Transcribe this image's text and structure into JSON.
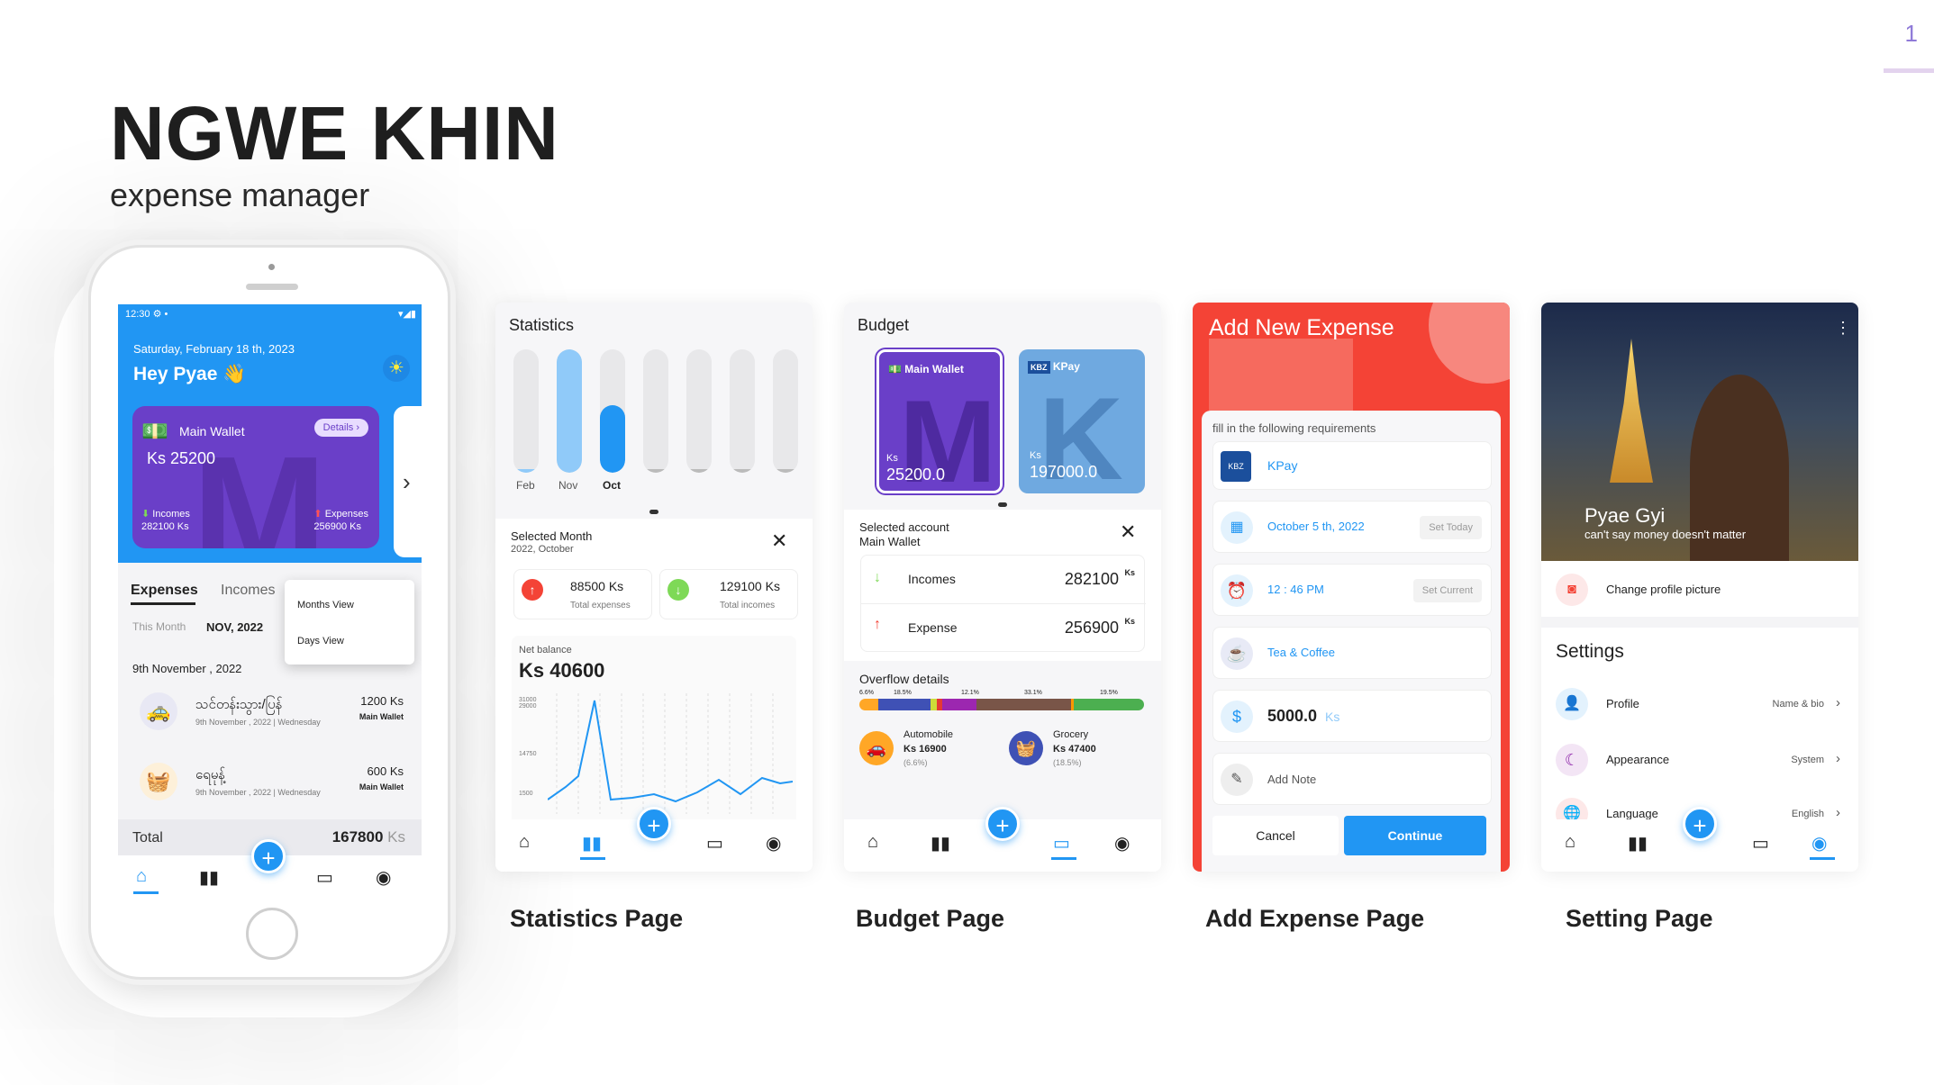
{
  "header": {
    "title": "NGWE KHIN",
    "subtitle": "expense manager",
    "page_number": "1"
  },
  "phone": {
    "status_time": "12:30",
    "date": "Saturday, February 18 th, 2023",
    "greeting": "Hey Pyae",
    "wave_emoji": "👋",
    "wallet": {
      "name": "Main Wallet",
      "details": "Details ›",
      "balance": "Ks 25200",
      "incomes_label": "Incomes",
      "incomes_value": "282100 Ks",
      "expenses_label": "Expenses",
      "expenses_value": "256900 Ks"
    },
    "tabs": {
      "expenses": "Expenses",
      "incomes": "Incomes"
    },
    "this_month": "This Month",
    "month": "NOV, 2022",
    "menu": {
      "months": "Months View",
      "days": "Days View"
    },
    "day_header": "9th November , 2022",
    "transactions": [
      {
        "name": "သင်တန်းသွား/ပြန်",
        "date": "9th November , 2022 | Wednesday",
        "amount": "1200 Ks",
        "wallet": "Main Wallet",
        "icon": "🚕",
        "bg": "#e8e8f4"
      },
      {
        "name": "ရေမုန့်",
        "date": "9th November , 2022 | Wednesday",
        "amount": "600 Ks",
        "wallet": "Main Wallet",
        "icon": "🧺",
        "bg": "#fdf0d9"
      }
    ],
    "total_label": "Total",
    "total_value": "167800",
    "total_unit": "Ks"
  },
  "statistics": {
    "title": "Statistics",
    "months": [
      "Feb",
      "Nov",
      "Oct"
    ],
    "bar_levels": [
      0.03,
      1.0,
      0.55,
      0.03,
      0.03,
      0.03,
      0.03
    ],
    "selected_label": "Selected Month",
    "selected_value": "2022, October",
    "total_expenses": "88500 Ks",
    "total_expenses_label": "Total expenses",
    "total_incomes": "129100 Ks",
    "total_incomes_label": "Total incomes",
    "net_label": "Net balance",
    "net_value": "Ks 40600",
    "y_ticks": [
      "31000",
      "29000",
      "14750",
      "1500"
    ],
    "caption": "Statistics Page"
  },
  "budget": {
    "title": "Budget",
    "wallets": [
      {
        "name": "Main Wallet",
        "unit": "Ks",
        "value": "25200.0"
      },
      {
        "name": "KPay",
        "unit": "Ks",
        "value": "197000.0"
      }
    ],
    "selected_label": "Selected account",
    "selected_value": "Main Wallet",
    "incomes_label": "Incomes",
    "incomes_value": "282100",
    "expense_label": "Expense",
    "expense_value": "256900",
    "unit_sup": "Ks",
    "overflow_title": "Overflow details",
    "overflow_pcts": [
      "6.6%",
      "18.5%",
      "12.1%",
      "33.1%",
      "19.5%"
    ],
    "cat1": {
      "name": "Automobile",
      "value": "Ks 16900",
      "pct": "(6.6%)"
    },
    "cat2": {
      "name": "Grocery",
      "value": "Ks 47400",
      "pct": "(18.5%)"
    },
    "caption": "Budget Page"
  },
  "add_expense": {
    "title": "Add New Expense",
    "hint": "fill in the following requirements",
    "wallet": "KPay",
    "date": "October 5 th, 2022",
    "set_today": "Set Today",
    "time": "12 : 46 PM",
    "set_current": "Set Current",
    "category": "Tea & Coffee",
    "amount": "5000.0",
    "amount_unit": "Ks",
    "note": "Add Note",
    "cancel": "Cancel",
    "continue": "Continue",
    "caption": "Add Expense Page"
  },
  "settings": {
    "user_name": "Pyae Gyi",
    "user_quote": "can't say money doesn't matter",
    "change_pic": "Change profile picture",
    "title": "Settings",
    "items": [
      {
        "label": "Profile",
        "value": "Name & bio"
      },
      {
        "label": "Appearance",
        "value": "System"
      },
      {
        "label": "Language",
        "value": "English"
      }
    ],
    "caption": "Setting Page"
  },
  "colors": {
    "primary": "#2196f3",
    "purple": "#6a3fc8",
    "red": "#f44336"
  }
}
